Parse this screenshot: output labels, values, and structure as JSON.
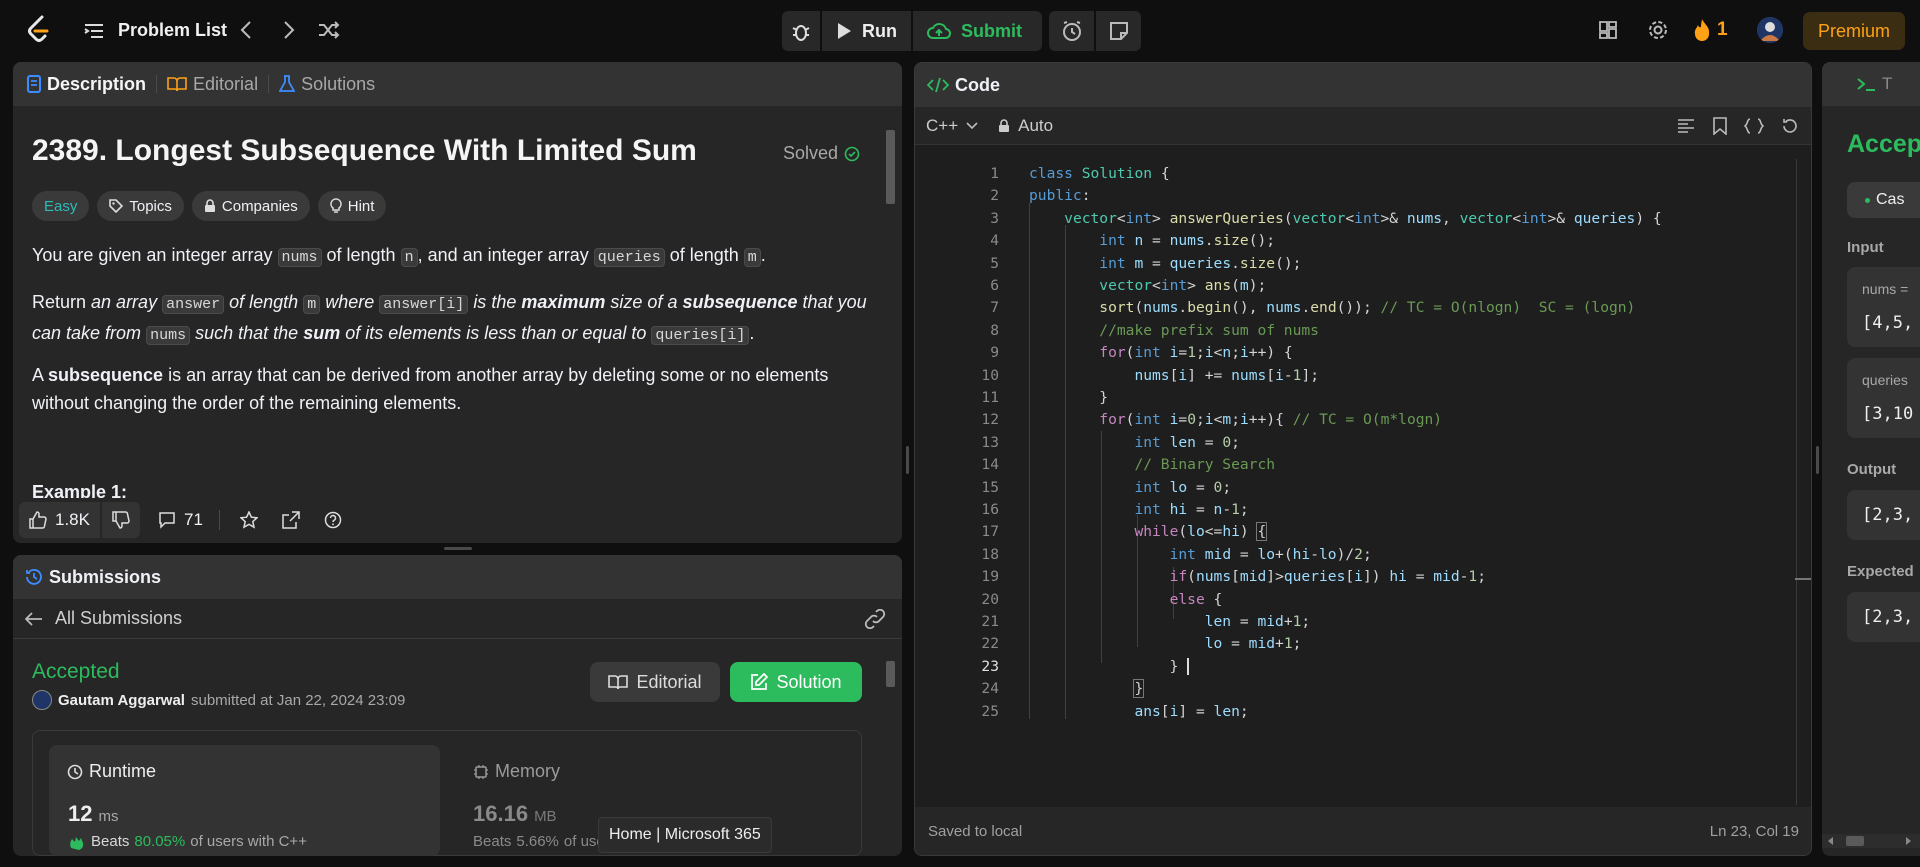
{
  "nav": {
    "problem_list": "Problem List",
    "run": "Run",
    "submit": "Submit",
    "streak": "1",
    "premium": "Premium"
  },
  "description": {
    "tabs": [
      "Description",
      "Editorial",
      "Solutions"
    ],
    "title": "2389. Longest Subsequence With Limited Sum",
    "solved": "Solved",
    "chips": [
      "Easy",
      "Topics",
      "Companies",
      "Hint"
    ],
    "p1": [
      "You are given an integer array ",
      "nums",
      " of length ",
      "n",
      ", and an integer array ",
      "queries",
      " of length ",
      "m",
      "."
    ],
    "p2": [
      "Return ",
      "an array",
      "answer",
      "of length",
      "m",
      "where",
      "answer[i]",
      "is the",
      "maximum",
      "size of a",
      "subsequence",
      "that you can take from",
      "nums",
      "such that the",
      "sum",
      "of its elements is less than or equal to",
      "queries[i]",
      "."
    ],
    "p3": [
      "A ",
      "subsequence",
      " is an array that can be derived from another array by deleting some or no elements without changing the order of the remaining elements."
    ],
    "example": "Example 1:",
    "likes": "1.8K",
    "comments": "71"
  },
  "submissions": {
    "title": "Submissions",
    "back": "All Submissions",
    "status": "Accepted",
    "user": "Gautam Aggarwal",
    "submitted": "submitted at Jan 22, 2024 23:09",
    "editorial_btn": "Editorial",
    "solution_btn": "Solution",
    "runtime_label": "Runtime",
    "runtime_value": "12",
    "runtime_unit": "ms",
    "runtime_beats_pre": "Beats",
    "runtime_beats": "80.05%",
    "runtime_beats_post": "of users with C++",
    "memory_label": "Memory",
    "memory_value": "16.16",
    "memory_unit": "MB",
    "memory_beats_pre": "Beats",
    "memory_beats": "5.66%",
    "memory_beats_post": "of users"
  },
  "code": {
    "title": "Code",
    "language": "C++",
    "mode": "Auto",
    "status_left": "Saved to local",
    "status_right": "Ln 23, Col 19",
    "current_line": 23
  },
  "testcase": {
    "tab": "T",
    "result": "Accep",
    "case": "Cas",
    "input_label": "Input",
    "nums_label": "nums =",
    "nums_value": "[4,5,",
    "queries_label": "queries",
    "queries_value": "[3,10",
    "output_label": "Output",
    "output_value": "[2,3,",
    "expected_label": "Expected",
    "expected_value": "[2,3,"
  },
  "tooltip": "Home | Microsoft 365",
  "colors": {
    "accent_green": "#2cbb5d",
    "premium": "#ffa116",
    "easy": "#2cbbb6"
  }
}
